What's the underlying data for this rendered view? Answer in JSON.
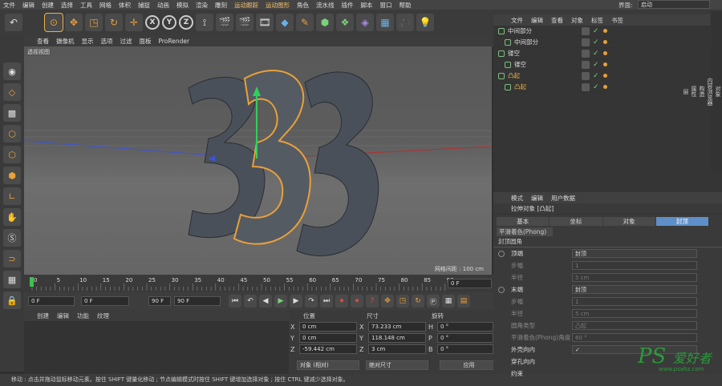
{
  "menu": [
    "文件",
    "编辑",
    "创建",
    "选择",
    "工具",
    "网格",
    "体积",
    "捕捉",
    "动画",
    "模拟",
    "渲染",
    "雕刻",
    "运动跟踪",
    "运动图形",
    "角色",
    "流水线",
    "插件",
    "脚本",
    "窗口",
    "帮助"
  ],
  "toolbar": {
    "x": "X",
    "y": "Y",
    "z": "Z"
  },
  "viewport": {
    "menu": [
      "查看",
      "摄像机",
      "显示",
      "选项",
      "过滤",
      "面板",
      "ProRender"
    ],
    "label": "透视视图",
    "grid_info": "网格间距 : 100 cm"
  },
  "timeline": {
    "ticks": [
      "0",
      "5",
      "10",
      "15",
      "20",
      "25",
      "30",
      "35",
      "40",
      "45",
      "50",
      "55",
      "60",
      "65",
      "70",
      "75",
      "80",
      "85",
      "90"
    ],
    "current": "0 F"
  },
  "transport": {
    "start": "0 F",
    "min": "0 F",
    "max": "90 F",
    "end": "90 F"
  },
  "material": {
    "menu": [
      "创建",
      "编辑",
      "功能",
      "纹理"
    ]
  },
  "coords": {
    "headers": [
      "位置",
      "尺寸",
      "旋转"
    ],
    "rows": [
      {
        "axis": "X",
        "pos": "0 cm",
        "size": "73.233 cm",
        "rlabel": "H",
        "rot": "0 °"
      },
      {
        "axis": "Y",
        "pos": "0 cm",
        "size": "118.148 cm",
        "rlabel": "P",
        "rot": "0 °"
      },
      {
        "axis": "Z",
        "pos": "-59.442 cm",
        "size": "3 cm",
        "rlabel": "B",
        "rot": "0 °"
      }
    ],
    "mode": "对象 (相对)",
    "size_mode": "绝对尺寸",
    "apply": "应用"
  },
  "status": "移动 : 点击并拖动鼠标移动元素。按住 SHIFT 键量化移动 ; 节点编辑模式时按住 SHIFT 键增加选择对象 ; 按住 CTRL 键减少选择对象。",
  "layout_label": "界面:",
  "layout_value": "启动",
  "objects": {
    "menu": [
      "文件",
      "编辑",
      "查看",
      "对象",
      "标签",
      "书签"
    ],
    "items": [
      {
        "name": "中间部分",
        "level": 0,
        "sel": false
      },
      {
        "name": "中间部分",
        "level": 1,
        "sel": false
      },
      {
        "name": "镂空",
        "level": 0,
        "sel": false
      },
      {
        "name": "镂空",
        "level": 1,
        "sel": false
      },
      {
        "name": "凸起",
        "level": 0,
        "sel": true
      },
      {
        "name": "凸起",
        "level": 1,
        "sel": true
      }
    ]
  },
  "side_tabs": [
    "对象",
    "内容浏览器",
    "构造",
    "属性",
    "层"
  ],
  "attributes": {
    "menu": [
      "模式",
      "编辑",
      "用户数据"
    ],
    "title": "拉伸对象 [凸起]",
    "tabs": [
      "基本",
      "坐标",
      "对象",
      "封顶"
    ],
    "active_tab": "封顶",
    "subtab": "平滑着色(Phong)",
    "section": "封顶圆角",
    "rows": [
      {
        "label": "顶端",
        "value": "封顶",
        "dim": false,
        "radio": true
      },
      {
        "label": "步幅",
        "value": "1",
        "dim": true,
        "radio": false
      },
      {
        "label": "半径",
        "value": "5 cm",
        "dim": true,
        "radio": false
      },
      {
        "label": "末端",
        "value": "封顶",
        "dim": false,
        "radio": true
      },
      {
        "label": "步幅",
        "value": "1",
        "dim": true,
        "radio": false
      },
      {
        "label": "半径",
        "value": "5 cm",
        "dim": true,
        "radio": false
      },
      {
        "label": "圆角类型",
        "value": "凸起",
        "dim": true,
        "radio": false
      },
      {
        "label": "平滑着色(Phong)角度",
        "value": "60 °",
        "dim": true,
        "radio": false
      },
      {
        "label": "外壳向内",
        "value": "✓",
        "dim": false,
        "radio": false
      },
      {
        "label": "穿孔向内",
        "value": "",
        "dim": false,
        "radio": false
      },
      {
        "label": "约束",
        "value": "",
        "dim": false,
        "radio": false
      }
    ]
  },
  "watermark": {
    "brand": "PS",
    "name": "爱好者",
    "url": "www.psahz.com"
  }
}
